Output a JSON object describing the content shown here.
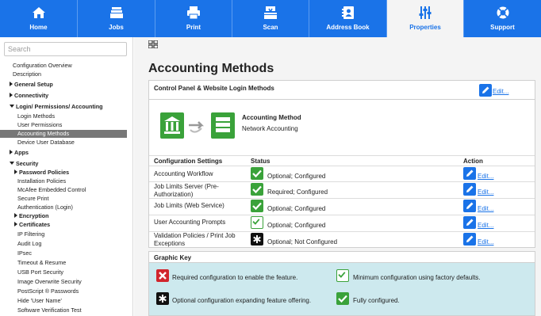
{
  "nav": {
    "tabs": [
      {
        "label": "Home",
        "icon": "home-icon"
      },
      {
        "label": "Jobs",
        "icon": "jobs-icon"
      },
      {
        "label": "Print",
        "icon": "printer-icon"
      },
      {
        "label": "Scan",
        "icon": "scan-icon"
      },
      {
        "label": "Address Book",
        "icon": "address-book-icon"
      },
      {
        "label": "Properties",
        "icon": "sliders-icon",
        "active": true
      },
      {
        "label": "Support",
        "icon": "lifebuoy-icon"
      }
    ],
    "accent": "#1a73e8"
  },
  "sidebar": {
    "search_placeholder": "Search",
    "items": [
      "Configuration Overview",
      "Description",
      "General Setup",
      "Connectivity",
      "Login/ Permissions/ Accounting",
      "Login Methods",
      "User Permissions",
      "Accounting Methods",
      "Device User Database",
      "Apps",
      "Security",
      "Password Policies",
      "Installation Policies",
      "McAfee Embedded Control",
      "Secure Print",
      "Authentication (Login)",
      "Encryption",
      "Certificates",
      "IP Filtering",
      "Audit Log",
      "IPsec",
      "Timeout & Resume",
      "USB Port Security",
      "Image Overwrite Security",
      "PostScript ® Passwords",
      "Hide 'User Name'",
      "Software Verification Test"
    ]
  },
  "main": {
    "title": "Accounting Methods",
    "panel_title": "Control Panel & Website Login Methods",
    "edit_label": "Edit...",
    "accounting_method_label": "Accounting Method",
    "accounting_method_value": "Network Accounting",
    "table": {
      "col_settings": "Configuration Settings",
      "col_status": "Status",
      "col_action": "Action",
      "rows": [
        {
          "name": "Accounting Workflow",
          "status": "Optional; Configured",
          "icon": "check-icon"
        },
        {
          "name": "Job Limits Server (Pre-Authorization)",
          "status": "Required; Configured",
          "icon": "check-icon"
        },
        {
          "name": "Job Limits (Web Service)",
          "status": "Optional; Configured",
          "icon": "check-icon"
        },
        {
          "name": "User Accounting Prompts",
          "status": "Optional; Configured",
          "icon": "check-outline-icon"
        },
        {
          "name": "Validation Policies / Print Job Exceptions",
          "status": "Optional; Not Configured",
          "icon": "asterisk-icon"
        }
      ]
    },
    "graphic_key": {
      "title": "Graphic Key",
      "items": [
        {
          "text": "Required configuration to enable the feature.",
          "icon": "x-icon"
        },
        {
          "text": "Minimum configuration using factory defaults.",
          "icon": "check-outline-icon"
        },
        {
          "text": "Optional configuration expanding feature offering.",
          "icon": "asterisk-icon"
        },
        {
          "text": "Fully configured.",
          "icon": "check-icon"
        }
      ]
    },
    "colors": {
      "green": "#3aa23a",
      "red": "#d1252c",
      "key_bg": "#cde9ee"
    }
  }
}
